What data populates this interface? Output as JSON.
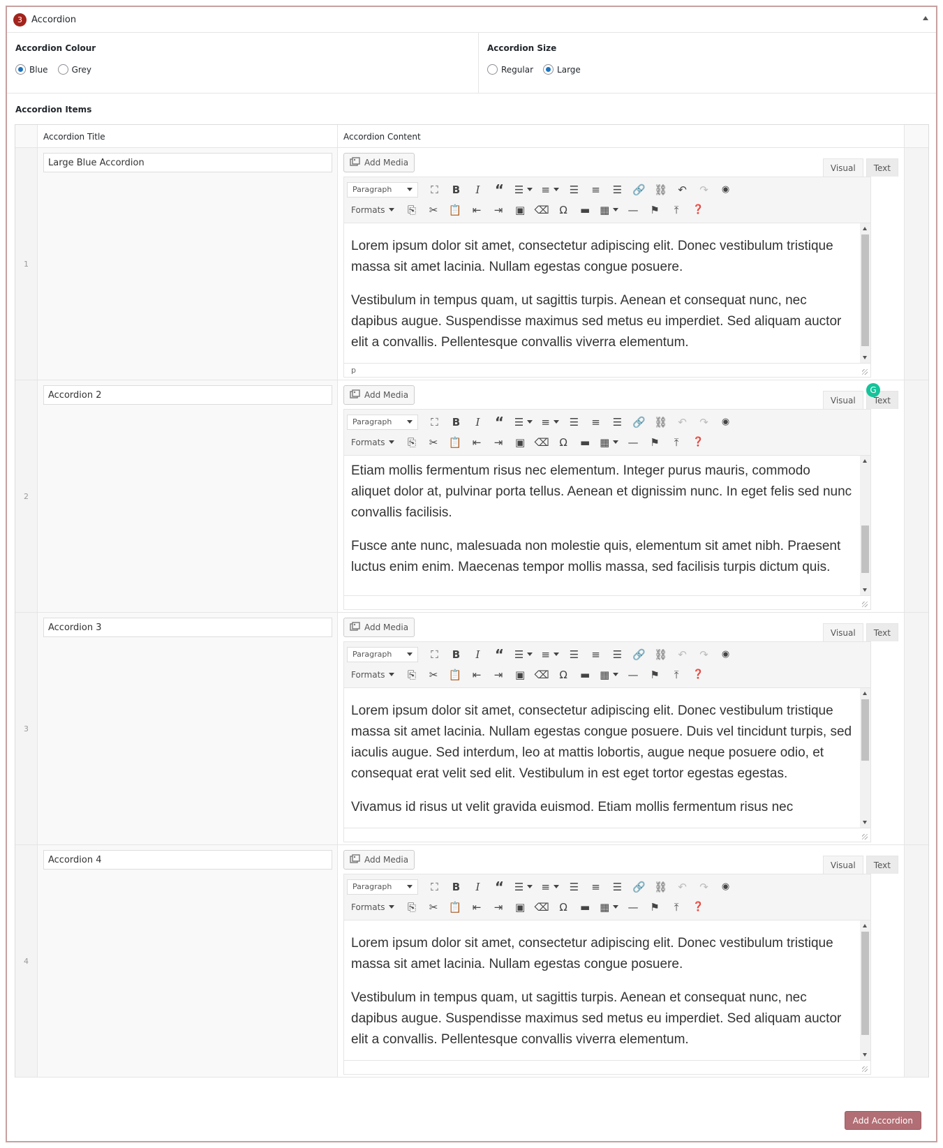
{
  "header": {
    "badge": "3",
    "title": "Accordion"
  },
  "colour": {
    "label": "Accordion Colour",
    "options": [
      "Blue",
      "Grey"
    ],
    "selected": "Blue"
  },
  "size": {
    "label": "Accordion Size",
    "options": [
      "Regular",
      "Large"
    ],
    "selected": "Large"
  },
  "items_label": "Accordion Items",
  "table": {
    "col_title": "Accordion Title",
    "col_content": "Accordion Content"
  },
  "editor": {
    "add_media": "Add Media",
    "tab_visual": "Visual",
    "tab_text": "Text",
    "format_select": "Paragraph",
    "formats_menu": "Formats",
    "status_path": "p"
  },
  "rows": [
    {
      "num": "1",
      "title": "Large Blue Accordion",
      "p1": "Lorem ipsum dolor sit amet, consectetur adipiscing elit. Donec vestibulum tristique massa sit amet lacinia. Nullam egestas congue posuere.",
      "p2": "Vestibulum in tempus quam, ut sagittis turpis. Aenean et consequat nunc, nec dapibus augue. Suspendisse maximus sed metus eu imperdiet. Sed aliquam auctor elit a convallis. Pellentesque convallis viverra elementum."
    },
    {
      "num": "2",
      "title": "Accordion 2",
      "p1": "Etiam mollis fermentum risus nec elementum. Integer purus mauris, commodo aliquet dolor at, pulvinar porta tellus. Aenean et dignissim nunc. In eget felis sed nunc convallis facilisis.",
      "p2": "Fusce ante nunc, malesuada non molestie quis, elementum sit amet nibh. Praesent luctus enim enim. Maecenas tempor mollis massa, sed facilisis turpis dictum quis."
    },
    {
      "num": "3",
      "title": "Accordion 3",
      "p1": "Lorem ipsum dolor sit amet, consectetur adipiscing elit. Donec vestibulum tristique massa sit amet lacinia. Nullam egestas congue posuere. Duis vel tincidunt turpis, sed iaculis augue. Sed interdum, leo at mattis lobortis, augue neque posuere odio, et consequat erat velit sed elit. Vestibulum in est eget tortor egestas egestas.",
      "p2": "Vivamus id risus ut velit gravida euismod. Etiam mollis fermentum risus nec"
    },
    {
      "num": "4",
      "title": "Accordion 4",
      "p1": "Lorem ipsum dolor sit amet, consectetur adipiscing elit. Donec vestibulum tristique massa sit amet lacinia. Nullam egestas congue posuere.",
      "p2": "Vestibulum in tempus quam, ut sagittis turpis. Aenean et consequat nunc, nec dapibus augue. Suspendisse maximus sed metus eu imperdiet. Sed aliquam auctor elit a convallis. Pellentesque convallis viverra elementum."
    }
  ],
  "footer": {
    "add_button": "Add Accordion"
  },
  "colors": {
    "badge": "#a3241c",
    "radio_on": "#1e73be",
    "add_button": "#b16e74",
    "grammarly": "#15c39a"
  }
}
